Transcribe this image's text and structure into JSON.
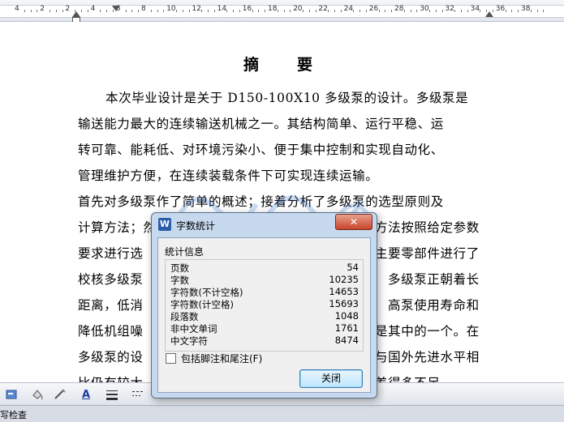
{
  "ruler": {
    "numbers": [
      "4",
      "2",
      "2",
      "4",
      "6",
      "8",
      "10",
      "12",
      "14",
      "16",
      "18",
      "20",
      "22",
      "24",
      "26",
      "28",
      "30",
      "32",
      "34",
      "36",
      "38"
    ]
  },
  "document": {
    "title": "摘　要",
    "lines": [
      "本次毕业设计是关于 D150-100X10 多级泵的设计。多级泵是",
      "输送能力最大的连续输送机械之一。其结构简单、运行平稳、运",
      "转可靠、能耗低、对环境污染小、便于集中控制和实现自动化、",
      "管理维护方便，在连续装载条件下可实现连续运输。",
      "首先对多级泵作了简单的概述；接着分析了多级泵的选型原则及",
      "计算方法；然",
      "要求进行选",
      "校核多级泵",
      "距离，低消",
      "降低机组噪",
      "多级泵的设",
      "比仍有较大"
    ],
    "right_fragments": [
      "方法按照给定参数",
      "主要零部件进行了",
      "多级泵正朝着长",
      "高泵使用寿命和",
      "是其中的一个。在",
      "与国外先进水平相",
      "差得多不足"
    ]
  },
  "dialog": {
    "title": "字数统计",
    "group_label": "统计信息",
    "stats": [
      {
        "label": "页数",
        "value": "54"
      },
      {
        "label": "字数",
        "value": "10235"
      },
      {
        "label": "字符数(不计空格)",
        "value": "14653"
      },
      {
        "label": "字符数(计空格)",
        "value": "15693"
      },
      {
        "label": "段落数",
        "value": "1048"
      },
      {
        "label": "非中文单词",
        "value": "1761"
      },
      {
        "label": "中文字符",
        "value": "8474"
      }
    ],
    "checkbox_label": "包括脚注和尾注(F)",
    "close_button": "关闭",
    "close_icon": "✕"
  },
  "toolbar": {
    "font_color_glyph": "A"
  },
  "status": {
    "text": "写检查"
  },
  "colors": {
    "dialog_frame": "#c7d9ee",
    "close_red": "#c9442a",
    "button_blue": "#bee6fd"
  }
}
